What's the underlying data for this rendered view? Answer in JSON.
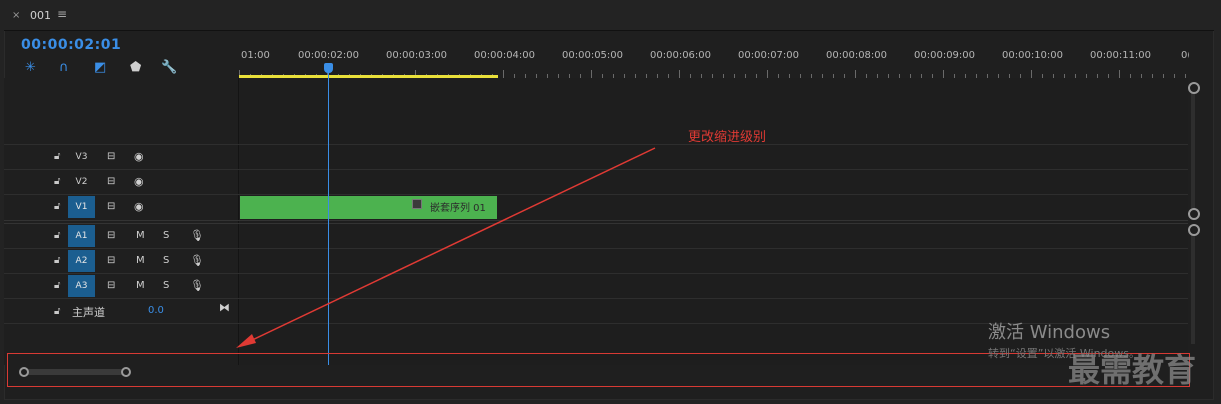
{
  "tab": {
    "close": "×",
    "title": "001",
    "menu": "≡"
  },
  "timecode": "00:00:02:01",
  "tools": [
    {
      "name": "snap-icon",
      "glyph": "✳",
      "color": "#3a8ee6"
    },
    {
      "name": "magnet-icon",
      "glyph": "∩",
      "color": "#3a8ee6"
    },
    {
      "name": "linked-selection-icon",
      "glyph": "◩",
      "color": "#3a8ee6"
    },
    {
      "name": "marker-icon",
      "glyph": "⬟",
      "color": "#cfcfcf"
    },
    {
      "name": "wrench-icon",
      "glyph": "🔧",
      "color": "#cfcfcf"
    }
  ],
  "ruler": {
    "labels": [
      "01:00",
      "00:00:02:00",
      "00:00:03:00",
      "00:00:04:00",
      "00:00:05:00",
      "00:00:06:00",
      "00:00:07:00",
      "00:00:08:00",
      "00:00:09:00",
      "00:00:10:00",
      "00:00:11:00",
      "0("
    ]
  },
  "tracks": {
    "video": [
      {
        "label": "V3",
        "selected": false
      },
      {
        "label": "V2",
        "selected": false
      },
      {
        "label": "V1",
        "selected": true
      }
    ],
    "audio": [
      {
        "label": "A1",
        "selected": true,
        "m": "M",
        "s": "S"
      },
      {
        "label": "A2",
        "selected": true,
        "m": "M",
        "s": "S"
      },
      {
        "label": "A3",
        "selected": true,
        "m": "M",
        "s": "S"
      }
    ]
  },
  "master": {
    "label": "主声道",
    "value": "0.0",
    "icon": "⧓"
  },
  "clip": {
    "name": "嵌套序列 01",
    "color": "#4cb24f"
  },
  "annotation": "更改缩进级别",
  "overlay": {
    "activate_title": "激活 Windows",
    "activate_sub": "转到“设置”以激活 Windows。",
    "watermark": "最需教育"
  },
  "colors": {
    "accent": "#3a8ee6",
    "work_area": "#e9e03a",
    "annotation": "#e03a34",
    "selected_track": "#1b5e90"
  }
}
